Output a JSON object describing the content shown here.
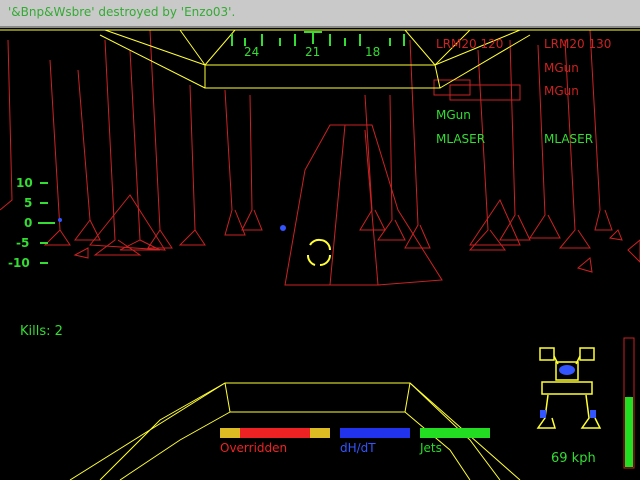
{
  "message_bar": {
    "text": "'&Bnp&Wsbre' destroyed by 'Enzo03'."
  },
  "compass": {
    "ticks": [
      "24",
      "21",
      "18"
    ]
  },
  "weapon_groups": [
    {
      "title": "LRM20 120",
      "weapons": [
        "MGun",
        "MLASER"
      ]
    },
    {
      "title": "LRM20 130",
      "weapons": [
        "MGun",
        "MGun",
        "MLASER"
      ]
    }
  ],
  "pitch_ladder": [
    "10",
    "5",
    "0",
    "-5",
    "-10"
  ],
  "kills": {
    "label": "Kills: 2"
  },
  "status_bars": {
    "overridden": {
      "label": "Overridden",
      "color": "#ee2222"
    },
    "dhdt": {
      "label": "dH/dT",
      "color": "#2233ee"
    },
    "jets": {
      "label": "Jets",
      "color": "#22dd22"
    }
  },
  "speed": {
    "label": "69 kph"
  },
  "throttle": {
    "level": 0.55
  },
  "colors": {
    "terrain": "#cc2222",
    "structure": "#ffff33",
    "hud": "#33dd33",
    "message": "#33aa33"
  }
}
